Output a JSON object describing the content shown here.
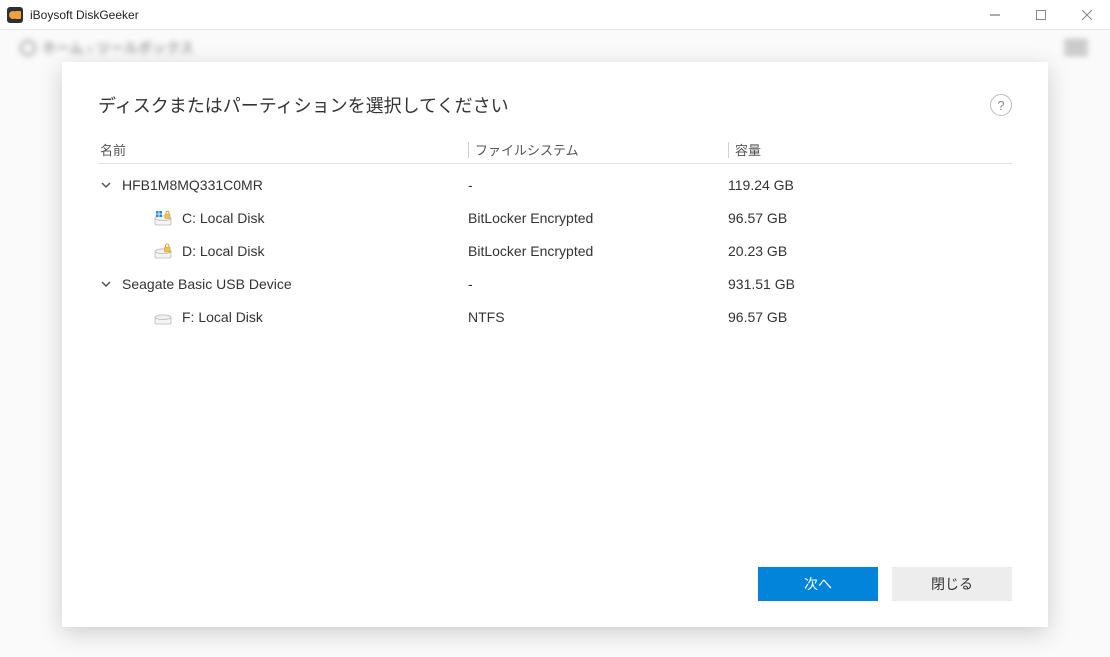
{
  "window": {
    "title": "iBoysoft DiskGeeker"
  },
  "background": {
    "breadcrumb": "ホーム › ツールボックス"
  },
  "dialog": {
    "title": "ディスクまたはパーティションを選択してください",
    "columns": {
      "name": "名前",
      "filesystem": "ファイルシステム",
      "capacity": "容量"
    },
    "disks": [
      {
        "name": "HFB1M8MQ331C0MR",
        "filesystem": "-",
        "capacity": "119.24 GB",
        "partitions": [
          {
            "icon": "windows-bitlocker",
            "name": "C: Local Disk",
            "filesystem": "BitLocker Encrypted",
            "capacity": "96.57 GB"
          },
          {
            "icon": "drive-lock",
            "name": "D: Local Disk",
            "filesystem": "BitLocker Encrypted",
            "capacity": "20.23 GB"
          }
        ]
      },
      {
        "name": "Seagate Basic USB Device",
        "filesystem": "-",
        "capacity": "931.51 GB",
        "partitions": [
          {
            "icon": "drive",
            "name": "F: Local Disk",
            "filesystem": "NTFS",
            "capacity": "96.57 GB"
          }
        ]
      }
    ],
    "buttons": {
      "next": "次へ",
      "close": "閉じる"
    }
  }
}
